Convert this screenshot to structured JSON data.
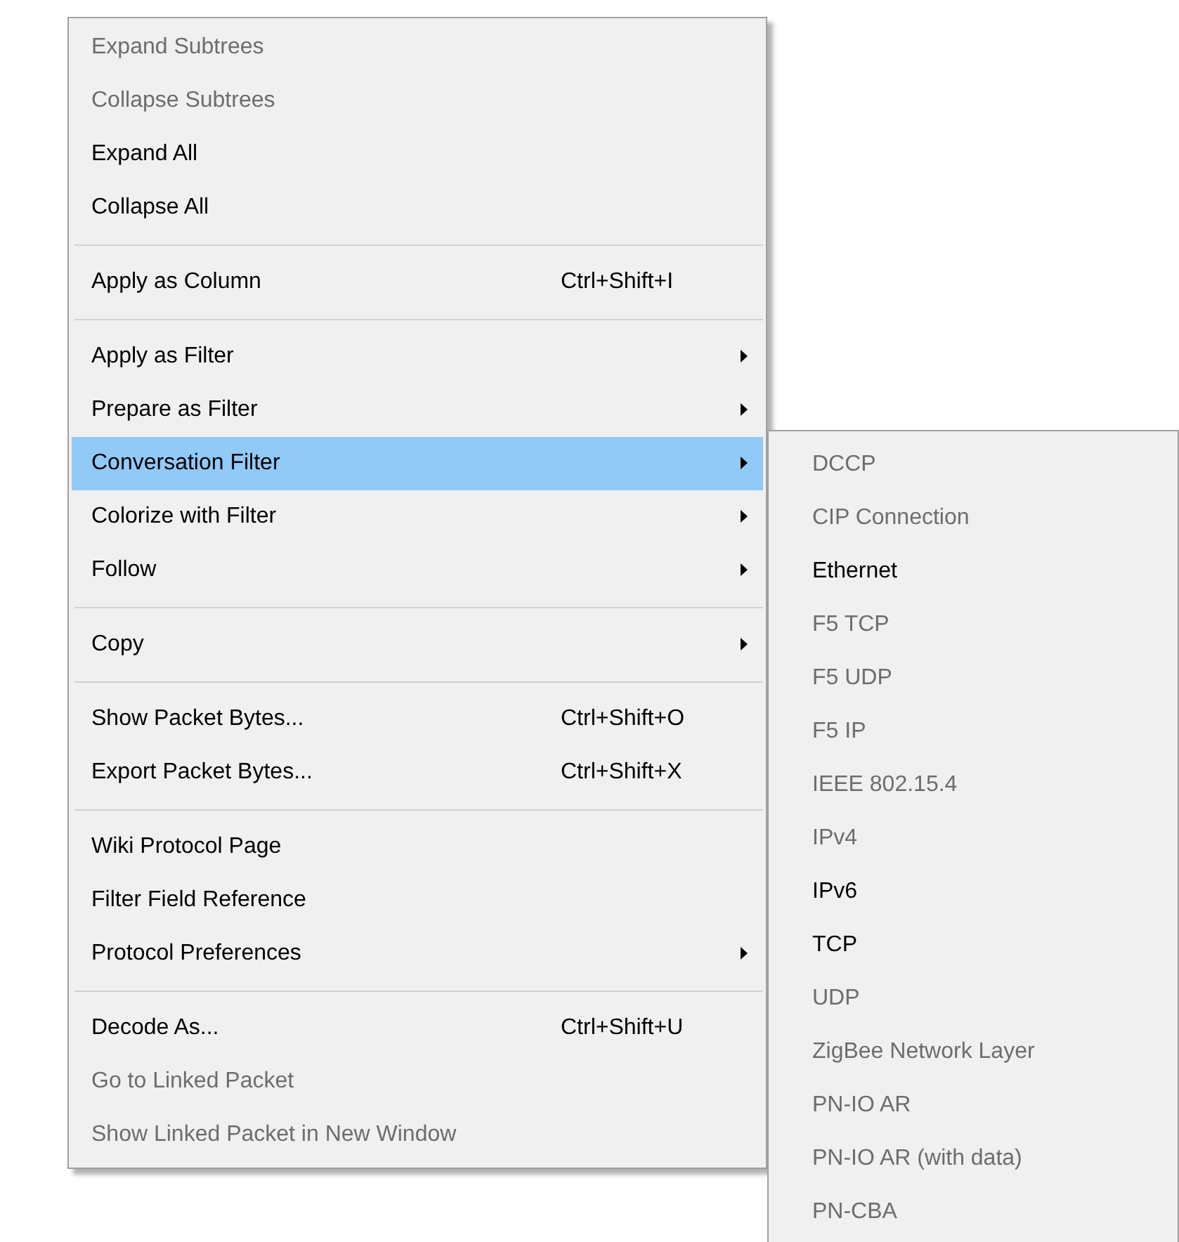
{
  "context_menu": {
    "items": [
      {
        "kind": "item",
        "label": "Expand Subtrees",
        "disabled": true,
        "selected": false,
        "submenu": false
      },
      {
        "kind": "item",
        "label": "Collapse Subtrees",
        "disabled": true,
        "selected": false,
        "submenu": false
      },
      {
        "kind": "item",
        "label": "Expand All",
        "disabled": false,
        "selected": false,
        "submenu": false
      },
      {
        "kind": "item",
        "label": "Collapse All",
        "disabled": false,
        "selected": false,
        "submenu": false
      },
      {
        "kind": "separator"
      },
      {
        "kind": "item",
        "label": "Apply as Column",
        "shortcut": "Ctrl+Shift+I",
        "disabled": false,
        "selected": false,
        "submenu": false
      },
      {
        "kind": "separator"
      },
      {
        "kind": "item",
        "label": "Apply as Filter",
        "disabled": false,
        "selected": false,
        "submenu": true
      },
      {
        "kind": "item",
        "label": "Prepare as Filter",
        "disabled": false,
        "selected": false,
        "submenu": true
      },
      {
        "kind": "item",
        "label": "Conversation Filter",
        "disabled": false,
        "selected": true,
        "submenu": true
      },
      {
        "kind": "item",
        "label": "Colorize with Filter",
        "disabled": false,
        "selected": false,
        "submenu": true
      },
      {
        "kind": "item",
        "label": "Follow",
        "disabled": false,
        "selected": false,
        "submenu": true
      },
      {
        "kind": "separator"
      },
      {
        "kind": "item",
        "label": "Copy",
        "disabled": false,
        "selected": false,
        "submenu": true
      },
      {
        "kind": "separator"
      },
      {
        "kind": "item",
        "label": "Show Packet Bytes...",
        "shortcut": "Ctrl+Shift+O",
        "disabled": false,
        "selected": false,
        "submenu": false
      },
      {
        "kind": "item",
        "label": "Export Packet Bytes...",
        "shortcut": "Ctrl+Shift+X",
        "disabled": false,
        "selected": false,
        "submenu": false
      },
      {
        "kind": "separator"
      },
      {
        "kind": "item",
        "label": "Wiki Protocol Page",
        "disabled": false,
        "selected": false,
        "submenu": false
      },
      {
        "kind": "item",
        "label": "Filter Field Reference",
        "disabled": false,
        "selected": false,
        "submenu": false
      },
      {
        "kind": "item",
        "label": "Protocol Preferences",
        "disabled": false,
        "selected": false,
        "submenu": true
      },
      {
        "kind": "separator"
      },
      {
        "kind": "item",
        "label": "Decode As...",
        "shortcut": "Ctrl+Shift+U",
        "disabled": false,
        "selected": false,
        "submenu": false
      },
      {
        "kind": "item",
        "label": "Go to Linked Packet",
        "disabled": true,
        "selected": false,
        "submenu": false
      },
      {
        "kind": "item",
        "label": "Show Linked Packet in New Window",
        "disabled": true,
        "selected": false,
        "submenu": false
      }
    ]
  },
  "submenu": {
    "items": [
      {
        "label": "DCCP",
        "disabled": true
      },
      {
        "label": "CIP Connection",
        "disabled": true
      },
      {
        "label": "Ethernet",
        "disabled": false
      },
      {
        "label": "F5 TCP",
        "disabled": true
      },
      {
        "label": "F5 UDP",
        "disabled": true
      },
      {
        "label": "F5 IP",
        "disabled": true
      },
      {
        "label": "IEEE 802.15.4",
        "disabled": true
      },
      {
        "label": "IPv4",
        "disabled": true
      },
      {
        "label": "IPv6",
        "disabled": false
      },
      {
        "label": "TCP",
        "disabled": false
      },
      {
        "label": "UDP",
        "disabled": true
      },
      {
        "label": "ZigBee Network Layer",
        "disabled": true
      },
      {
        "label": "PN-IO AR",
        "disabled": true
      },
      {
        "label": "PN-IO AR (with data)",
        "disabled": true
      },
      {
        "label": "PN-CBA",
        "disabled": true
      }
    ]
  }
}
